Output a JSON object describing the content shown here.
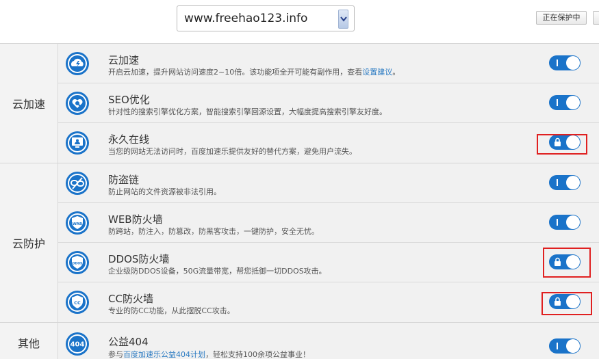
{
  "header": {
    "site_value": "www.freehao123.info",
    "protect_label": "正在保护中"
  },
  "groups": [
    {
      "label": "云加速",
      "items": [
        {
          "title": "云加速",
          "desc": "开启云加速，提升网站访问速度2~10倍。该功能项全开可能有副作用，查看",
          "link": "设置建议",
          "desc_after": "。",
          "icon": "cloud-speed-icon",
          "locked": false
        },
        {
          "title": "SEO优化",
          "desc": "针对性的搜索引擎优化方案，智能搜索引擎回源设置，大幅度提高搜索引擎友好度。",
          "icon": "seo-heart-search-icon",
          "locked": false
        },
        {
          "title": "永久在线",
          "desc": "当您的网站无法访问时，百度加速乐提供友好的替代方案，避免用户流失。",
          "icon": "monitor-user-icon",
          "locked": true
        }
      ]
    },
    {
      "label": "云防护",
      "items": [
        {
          "title": "防盗链",
          "desc": "防止网站的文件资源被非法引用。",
          "icon": "broken-link-icon",
          "locked": false
        },
        {
          "title": "WEB防火墙",
          "desc": "防跨站，防注入，防篡改，防黑客攻击，一键防护，安全无忧。",
          "icon": "waf-shield-icon",
          "icon_text": "WAB",
          "locked": false
        },
        {
          "title": "DDOS防火墙",
          "desc": "企业级防DDOS设备，50G流量带宽，帮您抵御一切DDOS攻击。",
          "icon": "ddos-shield-icon",
          "icon_text": "DDOS",
          "locked": true
        },
        {
          "title": "CC防火墙",
          "desc": "专业的防CC功能，从此摆脱CC攻击。",
          "icon": "cc-shield-icon",
          "icon_text": "CC",
          "locked": true
        }
      ]
    },
    {
      "label": "其他",
      "items": [
        {
          "title": "公益404",
          "desc_before": "参与",
          "link": "百度加速乐公益404计划",
          "desc": "，轻松支持100余项公益事业！",
          "icon": "charity-404-icon",
          "icon_text": "404",
          "locked": false
        }
      ]
    }
  ],
  "colors": {
    "toggle_on": "#1a73c9",
    "icon_blue": "#1a73c9",
    "highlight": "#e02020",
    "link": "#2a7ac2"
  }
}
